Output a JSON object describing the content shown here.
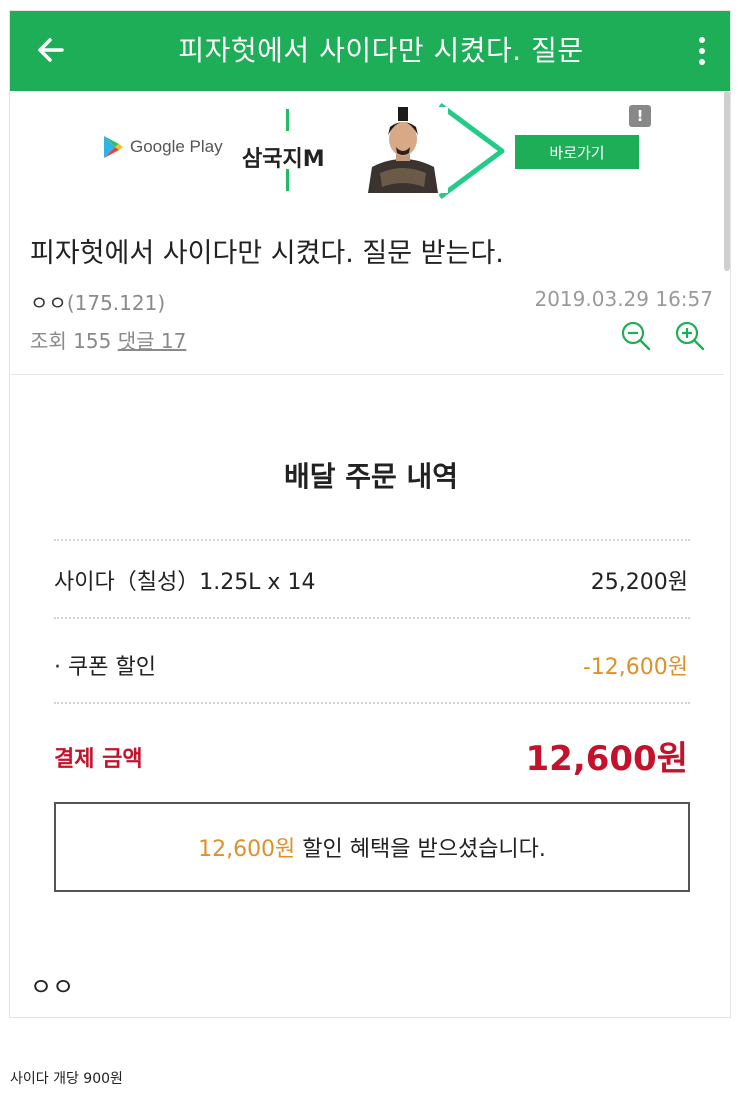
{
  "appbar": {
    "title": "피자헛에서 사이다만 시켰다. 질문",
    "back_icon": "arrow-left-icon",
    "menu_icon": "more-vert-icon",
    "color": "#1fae58"
  },
  "ad": {
    "store_label": "Google Play",
    "game_title": "삼국지M",
    "cta_label": "바로가기",
    "badge": "!"
  },
  "post": {
    "title": "피자헛에서 사이다만 시켰다. 질문 받는다.",
    "author_name": "ㅇㅇ",
    "author_ip": "(175.121)",
    "date": "2019.03.29 16:57",
    "views_label": "조회 155",
    "comments_label": "댓글 17",
    "zoom_out_icon": "zoom-out-icon",
    "zoom_in_icon": "zoom-in-icon"
  },
  "order": {
    "heading": "배달 주문 내역",
    "items": [
      {
        "label": "사이다（칠성）1.25L x 14",
        "value": "25,200원"
      },
      {
        "label": "· 쿠폰 할인",
        "value": "-12,600원"
      }
    ],
    "total_label": "결제 금액",
    "total_value": "12,600원",
    "benefit_amount": "12,600원",
    "benefit_text": " 할인 혜택을 받으셨습니다.",
    "colors": {
      "total": "#c4122b",
      "discount": "#e0902a"
    }
  },
  "signature": "ㅇㅇ",
  "caption": "사이다 개당 900원"
}
